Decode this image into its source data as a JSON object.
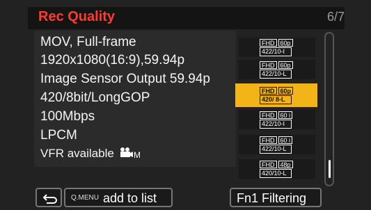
{
  "header": {
    "title": "Rec Quality",
    "page": "6/7"
  },
  "info": {
    "line1": "MOV, Full-frame",
    "line2": "1920x1080(16:9),59.94p",
    "line3": "Image Sensor Output 59.94p",
    "line4": "420/8bit/LongGOP",
    "line5": "100Mbps",
    "line6": "LPCM",
    "line7": "VFR available"
  },
  "list": {
    "items": [
      {
        "res": "FHD",
        "rate": "60p",
        "spec": "422/10-I"
      },
      {
        "res": "FHD",
        "rate": "60p",
        "spec": "422/10-L"
      },
      {
        "res": "FHD",
        "rate": "60p",
        "spec": "420/ 8-L"
      },
      {
        "res": "FHD",
        "rate": "60 i",
        "spec": "422/10-I"
      },
      {
        "res": "FHD",
        "rate": "60 i",
        "spec": "422/10-L"
      },
      {
        "res": "FHD",
        "rate": "48p",
        "spec": "420/10-L"
      }
    ],
    "selected_index": 2
  },
  "footer": {
    "qmenu": "Q.MENU",
    "add_label": "add to list",
    "filter_label": "Fn1 Filtering"
  },
  "colors": {
    "accent": "#ff3b2f",
    "selected": "#f2b417"
  }
}
